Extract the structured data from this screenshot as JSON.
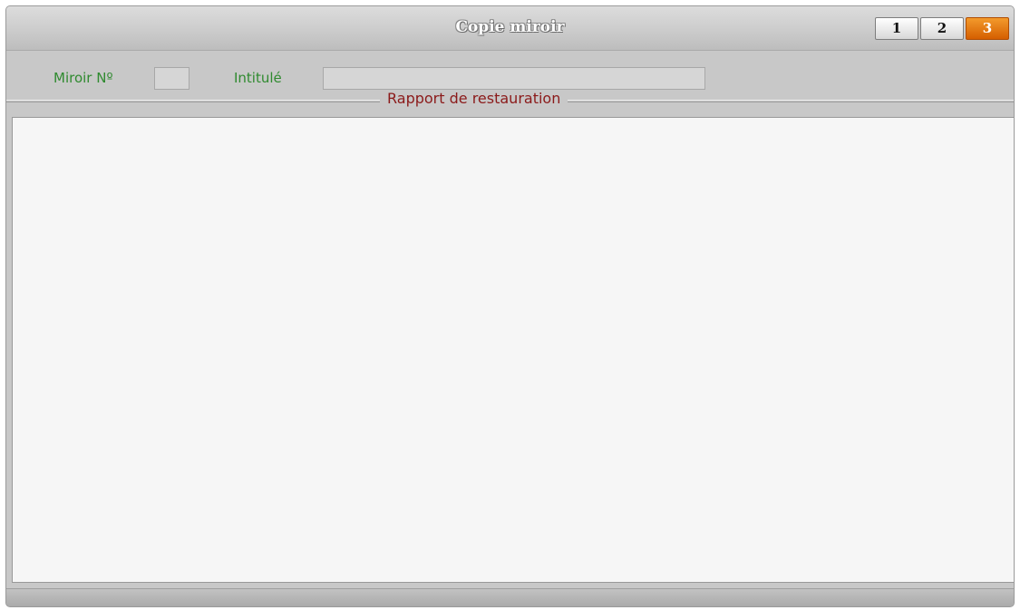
{
  "window": {
    "title": "Copie miroir"
  },
  "tabs": [
    "1",
    "2",
    "3"
  ],
  "active_tab": "3",
  "fields": {
    "miroir_label": "Miroir Nº",
    "miroir_value": "",
    "intitule_label": "Intitulé",
    "intitule_value": ""
  },
  "report": {
    "title": "Rapport de restauration",
    "content": ""
  },
  "colors": {
    "label_green": "#2f8a2f",
    "section_red": "#8b1a1a",
    "active_tab_orange": "#e06f0c"
  }
}
